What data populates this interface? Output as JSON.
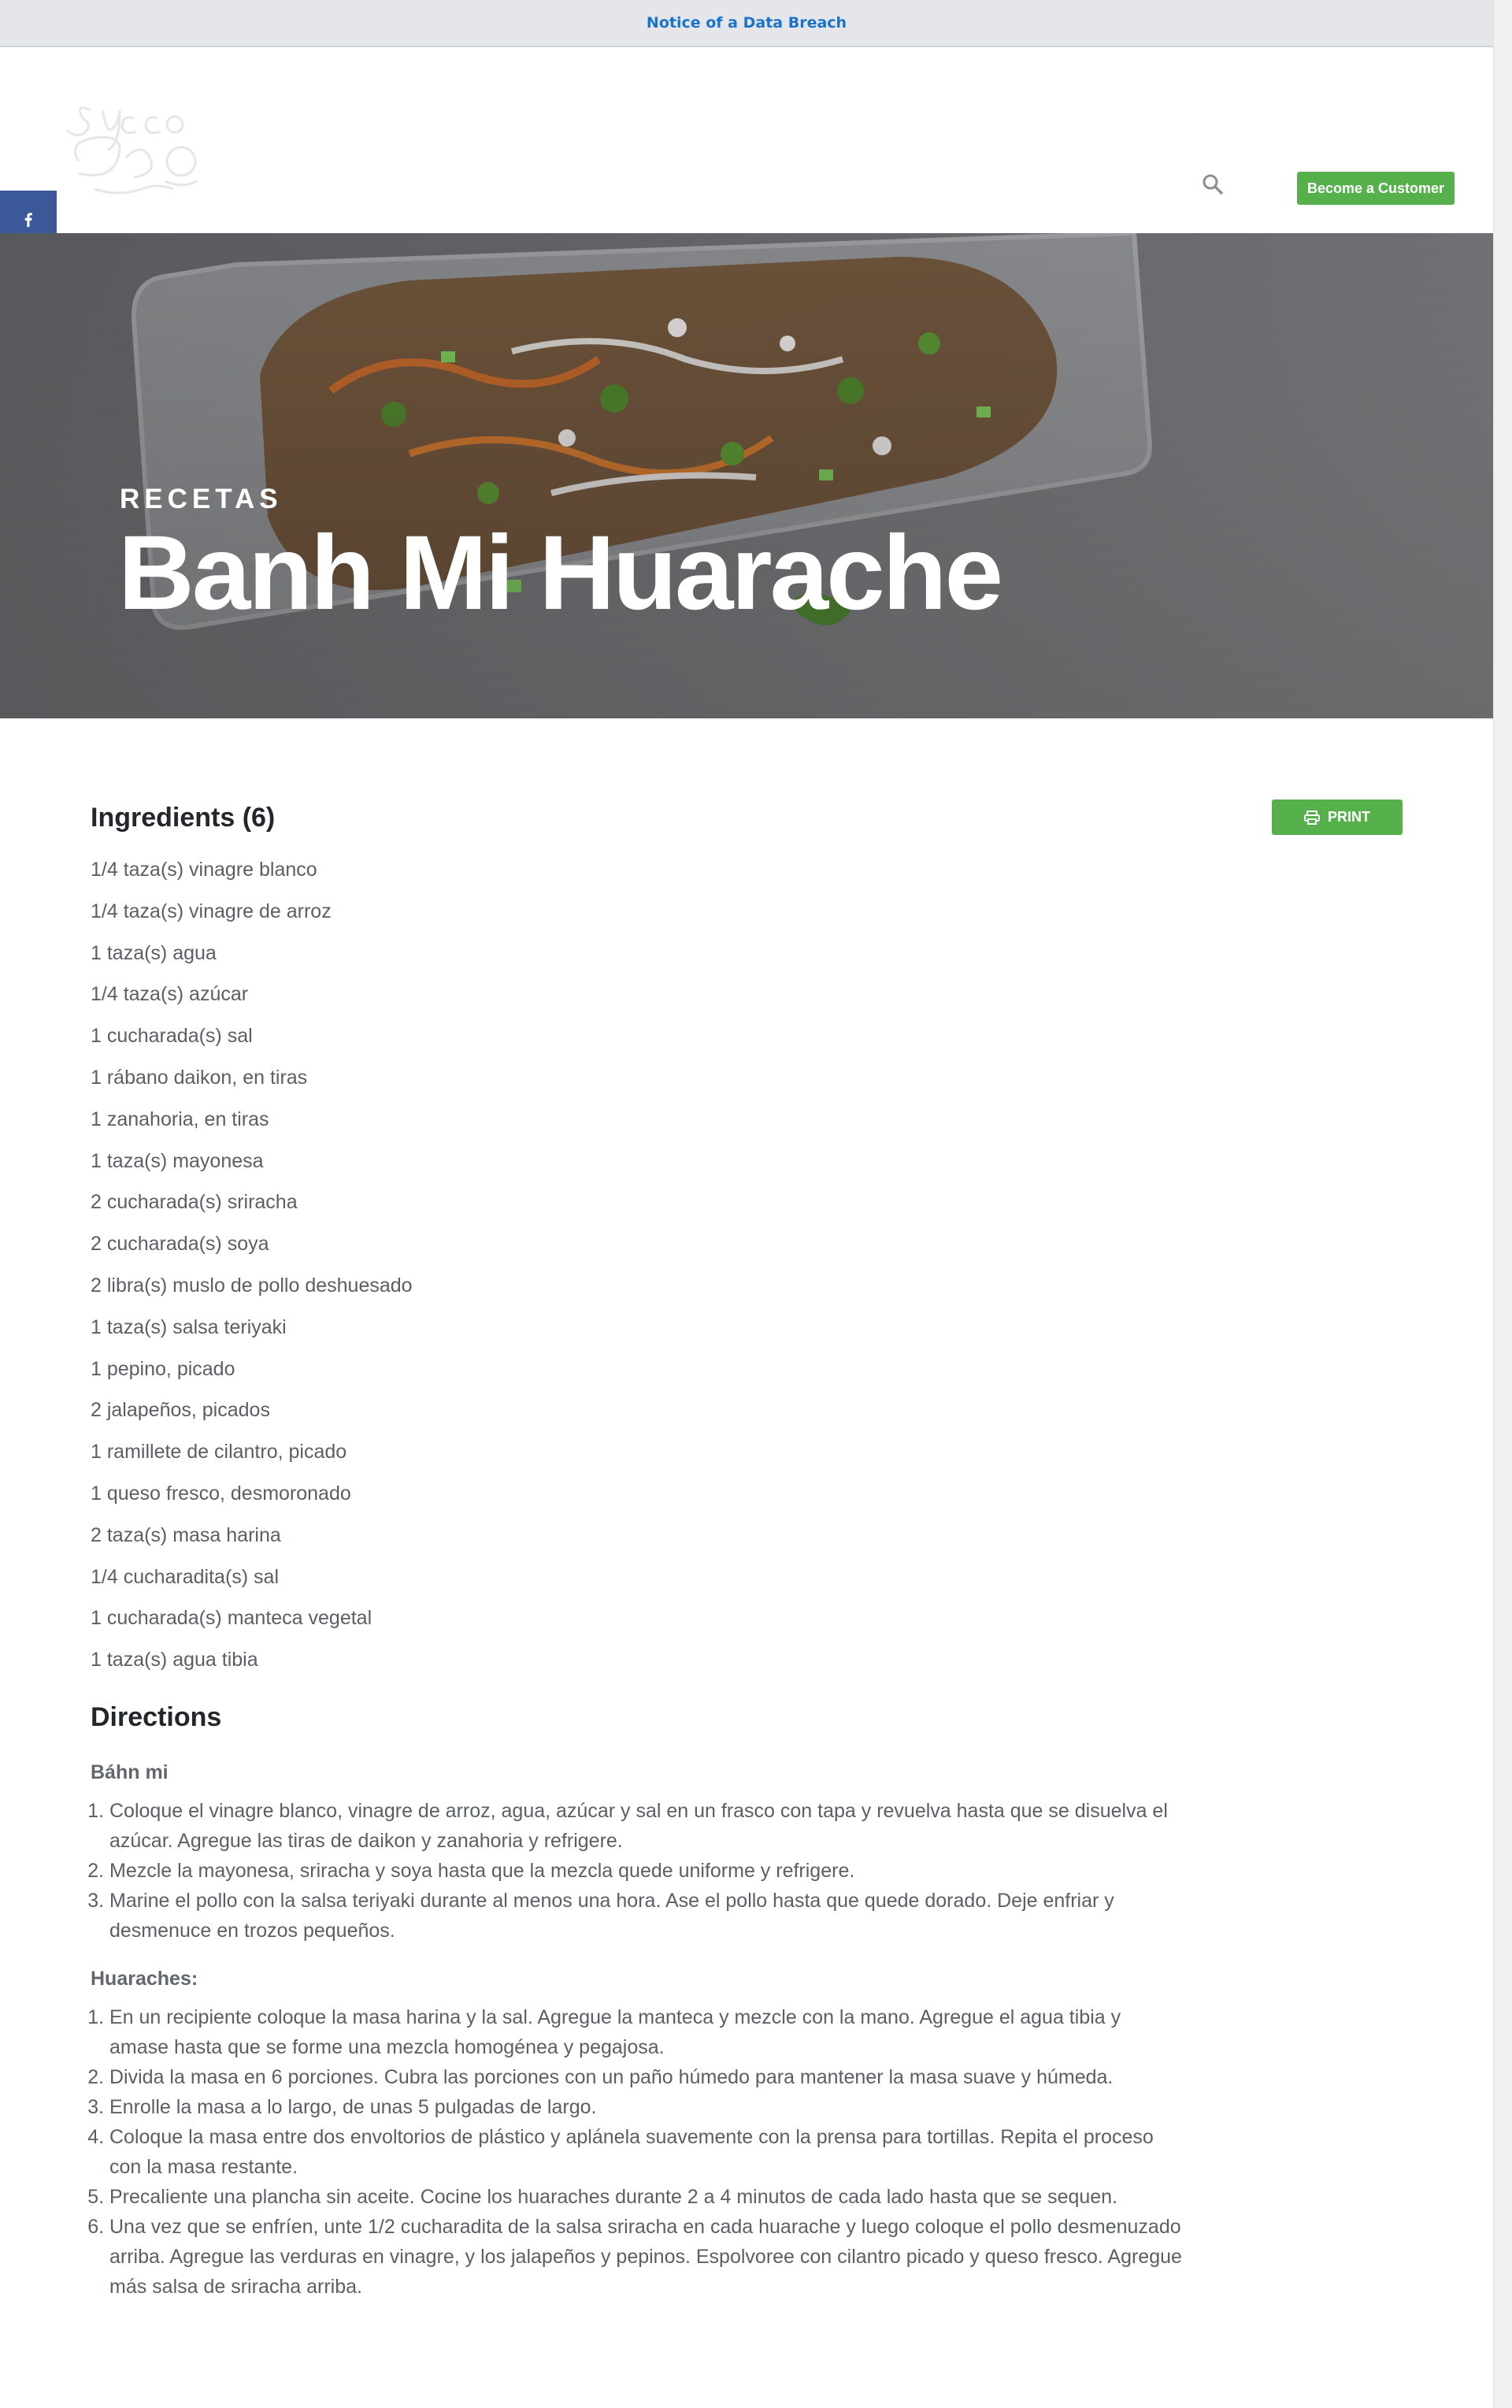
{
  "notice": {
    "text": "Notice of a Data Breach"
  },
  "header": {
    "logo_alt": "Sysco logo",
    "search_icon": "search-icon",
    "cta_label": "Become a Customer",
    "cta_color": "#56b14c"
  },
  "share": {
    "items": [
      {
        "icon": "facebook-icon",
        "color": "#3b5998"
      },
      {
        "icon": "x-twitter-icon",
        "color": "#000000"
      },
      {
        "icon": "pinterest-icon",
        "color": "#cb2027"
      },
      {
        "icon": "email-icon",
        "color": "#7d7d7d"
      },
      {
        "icon": "share-icon",
        "color": "#95d03a"
      }
    ]
  },
  "hero": {
    "kicker": "RECETAS",
    "title": "Banh Mi Huarache"
  },
  "recipe": {
    "print_label": "PRINT",
    "ingredients_heading": "Ingredients (6)",
    "ingredients": [
      "1/4 taza(s) vinagre blanco",
      "1/4 taza(s) vinagre de arroz",
      "1 taza(s) agua",
      "1/4 taza(s) azúcar",
      "1 cucharada(s) sal",
      "1 rábano daikon, en tiras",
      "1 zanahoria, en tiras",
      "1 taza(s) mayonesa",
      "2 cucharada(s) sriracha",
      "2 cucharada(s) soya",
      "2 libra(s) muslo de pollo deshuesado",
      "1 taza(s) salsa teriyaki",
      "1 pepino, picado",
      "2 jalapeños, picados",
      "1 ramillete de cilantro, picado",
      "1 queso fresco, desmoronado",
      "2 taza(s) masa harina",
      "1/4 cucharadita(s) sal",
      "1 cucharada(s) manteca vegetal",
      "1 taza(s) agua tibia"
    ],
    "directions_heading": "Directions",
    "banh_mi_heading": "Báhn mi",
    "banh_mi_steps": [
      "Coloque el vinagre blanco, vinagre de arroz, agua, azúcar y sal en un frasco con tapa y revuelva hasta que se disuelva el azúcar. Agregue las tiras de daikon y zanahoria y refrigere.",
      "Mezcle la mayonesa, sriracha y soya hasta que la mezcla quede uniforme y refrigere.",
      "Marine el pollo con la salsa teriyaki durante al menos una hora. Ase el pollo hasta que quede dorado. Deje enfriar y desmenuce en trozos pequeños."
    ],
    "huaraches_heading": "Huaraches:",
    "huaraches_steps": [
      "En un recipiente coloque la masa harina y la sal. Agregue la manteca y mezcle con la mano. Agregue el agua tibia y amase hasta que se forme una mezcla homogénea y pegajosa.",
      "Divida la masa en 6 porciones. Cubra las porciones con un paño húmedo para mantener la masa suave y húmeda.",
      "Enrolle la masa a lo largo, de unas 5 pulgadas de largo.",
      "Coloque la masa entre dos envoltorios de plástico y aplánela suavemente con la prensa para tortillas. Repita el proceso con la masa restante.",
      "Precaliente una plancha sin aceite. Cocine los huaraches durante 2 a 4 minutos de cada lado hasta que se sequen.",
      "Una vez que se enfríen, unte 1/2 cucharadita de la salsa sriracha en cada huarache y luego coloque el pollo desmenuzado arriba. Agregue las verduras en vinagre, y los jalapeños y pepinos. Espolvoree con cilantro picado y queso fresco. Agregue más salsa de sriracha arriba."
    ]
  }
}
